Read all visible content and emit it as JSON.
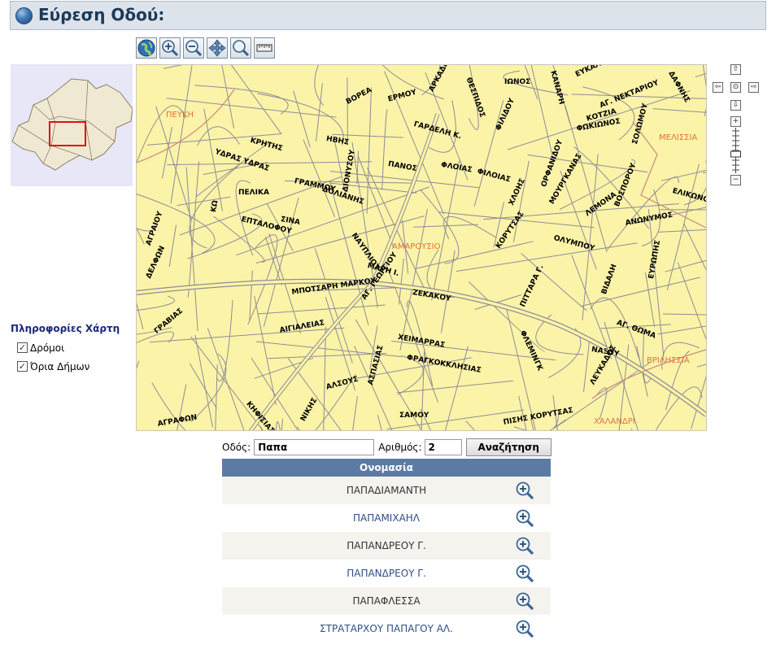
{
  "header": {
    "title": "Εύρεση Οδού:"
  },
  "toolbar": {
    "tools": [
      "globe-icon",
      "zoom-in-icon",
      "zoom-out-icon",
      "pan-icon",
      "zoom-window-icon",
      "measure-icon"
    ]
  },
  "map": {
    "street_labels": [
      "ΒΟΡΕΑ",
      "ΕΡΜΟΥ",
      "ΑΡΚΑΔΙΟΥ",
      "ΘΕΣΠΙΔΟΣ",
      "ΙΩΝΟΣ",
      "ΚΑΝΑΡΗ",
      "ΕΥΚΑΛΥΠΤΩΝ",
      "ΑΓ. ΝΕΚΤΑΡΙΟΥ",
      "ΔΑΦΝΗΣ",
      "ΚΟΤΖΙΑ",
      "ΓΑΡΔΕΛΗ Κ.",
      "ΚΡΗΤΗΣ",
      "ΗΒΗΣ",
      "ΦΙΛΙΔΟΥ",
      "ΦΩΚΙΩΝΟΣ",
      "ΥΔΡΑΣ ΥΔΡΑΣ",
      "ΠΑΝΟΣ",
      "ΦΛΟΙΑΣ",
      "ΦΙΛΟΙΑΣ",
      "ΣΟΛΩΜΟΥ",
      "ΜΟΥΡΓΚΑΝΑΣ",
      "ΕΛΙΚΩΝΟΣ",
      "ΑΓΡΑΙΟΥ",
      "ΓΡΑΜΜΟΥ",
      "ΔΟΛΙΑΝΗΣ",
      "ΠΕΛΙΚΑ",
      "ΧΛΟΗΣ",
      "ΟΡΦΑΝΙΔΟΥ",
      "ΛΕΜΟΝΑ",
      "ΒΟΣΠΟΡΟΥ",
      "ΕΠΤΑΛΟΦΟΥ",
      "ΣΙΝΑ",
      "ΝΑΥΠΛΙΟΥ",
      "ΚΟΡΥΤΣΑΣ",
      "ΑΝΩΝΥΜΟΣ",
      "ΔΕΛΦΩΝ",
      "ΜΑΡΗ Ι.",
      "ΟΛΥΜΠΟΥ",
      "ΒΙΔΑΛΗ",
      "ΕΥΡΩΠΗΣ",
      "ΜΠΟΤΣΑΡΗ ΜΑΡΚΟΥ",
      "ΖΕΚΑΚΟΥ",
      "ΠΙΤΤΑΡΑ Γ.",
      "ΓΡΑΒΙΑΣ",
      "ΑΓ. ΓΕΩΡΓΙΟΥ",
      "ΦΛΕΜΙΝΓΚ",
      "ΑΓ. ΘΩΜΑ",
      "ΑΙΓΙΑΛΕΙΑΣ",
      "ΧΕΙΜΑΡΡΑΣ",
      "ΝΑΞΟΥ",
      "ΦΡΑΓΚΟΚΚΛΗΣΙΑΣ",
      "ΚΗΦΙΣΙΑΣ ΛΕΩΦ.",
      "ΑΛΣΟΥΣ",
      "ΑΣΠΑΣΙΑΣ",
      "ΛΕΥΚΑΔΟΣ",
      "ΣΑΜΟΥ",
      "ΝΙΚΗΣ",
      "ΑΓΡΑΦΩΝ",
      "ΠΙΣΗΣ ΚΟΡΥΤΣΑΣ",
      "ΔΙΟΝΥΣΟΥ",
      "ΚΩ"
    ],
    "areas": [
      "ΠΕΥΚΗ",
      "ΜΕΛΙΣΣΙΑ",
      "ΑΜΑΡΟΥΣΙΟ",
      "ΒΡΙΛΗΣΣΙΑ",
      "ΧΑΛΑΝΔΡΙ"
    ]
  },
  "layers": {
    "title": "Πληροφορίες Χάρτη",
    "items": [
      {
        "label": "Δρόμοι",
        "checked": true
      },
      {
        "label": "Όρια Δήμων",
        "checked": true
      }
    ]
  },
  "search": {
    "street_label": "Οδός:",
    "street_value": "Παπα",
    "number_label": "Αριθμός:",
    "number_value": "2",
    "button_label": "Αναζήτηση"
  },
  "results": {
    "header": "Ονομασία",
    "rows": [
      "ΠΑΠΑΔΙΑΜΑΝΤΗ",
      "ΠΑΠΑΜΙΧΑΗΛ",
      "ΠΑΠΑΝΔΡΕΟΥ Γ.",
      "ΠΑΠΑΝΔΡΕΟΥ Γ.",
      "ΠΑΠΑΦΛΕΣΣΑ",
      "ΣΤΡΑΤΑΡΧΟΥ ΠΑΠΑΓΟΥ ΑΛ."
    ]
  }
}
